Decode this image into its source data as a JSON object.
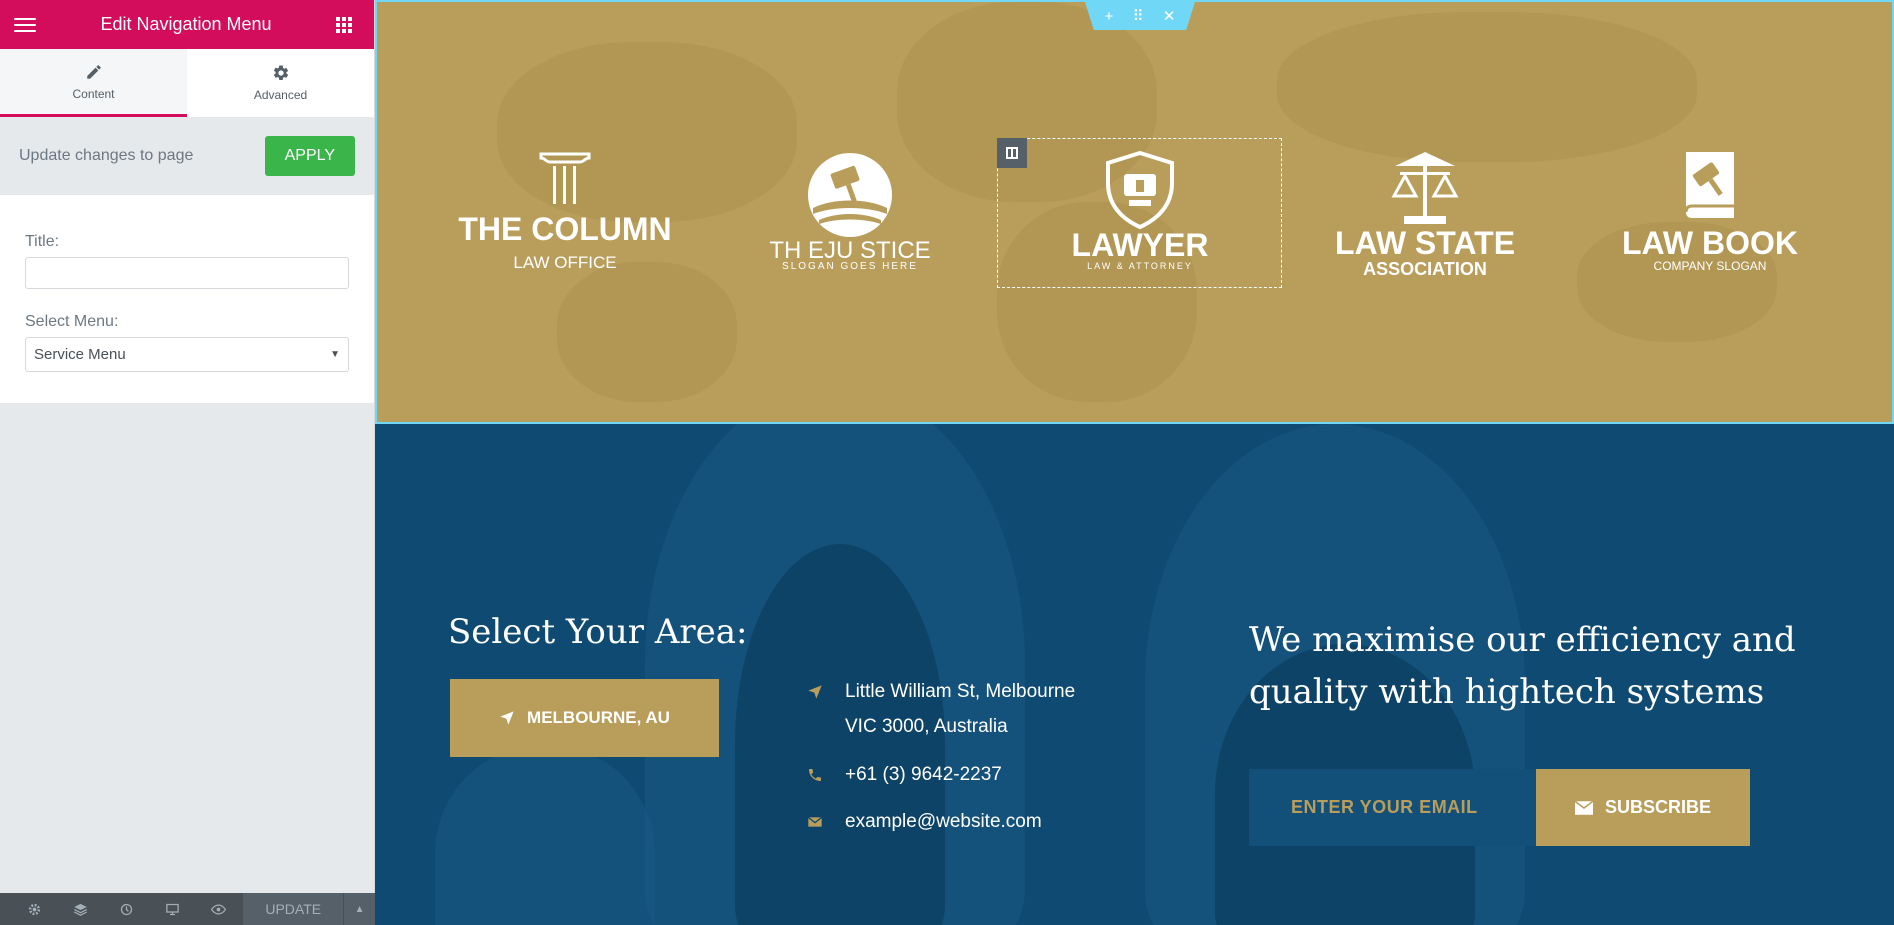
{
  "panel": {
    "header_title": "Edit Navigation Menu",
    "tabs": [
      {
        "label": "Content",
        "icon": "pencil-icon",
        "active": true
      },
      {
        "label": "Advanced",
        "icon": "gear-icon",
        "active": false
      }
    ],
    "apply_text": "Update changes to page",
    "apply_label": "APPLY",
    "title_label": "Title:",
    "title_value": "",
    "menu_label": "Select Menu:",
    "menu_value": "Service Menu",
    "footer": {
      "icons": [
        "settings-icon",
        "layers-icon",
        "history-icon",
        "responsive-icon",
        "preview-icon"
      ],
      "update_label": "UPDATE"
    }
  },
  "logos": [
    {
      "name": "THE COLUMN",
      "sub": "LAW OFFICE",
      "icon": "column-icon"
    },
    {
      "name": "TH EJU STICE",
      "sub": "SLOGAN GOES HERE",
      "icon": "gavel-circle-icon"
    },
    {
      "name": "LAWYER",
      "sub": "LAW & ATTORNEY",
      "icon": "shield-gavel-icon"
    },
    {
      "name": "LAW STATE",
      "sub": "ASSOCIATION",
      "icon": "scales-icon"
    },
    {
      "name": "LAW BOOK",
      "sub": "COMPANY SLOGAN",
      "icon": "book-gavel-icon"
    }
  ],
  "contact": {
    "area_heading": "Select Your Area:",
    "location_label": "MELBOURNE, AU",
    "address_line1": "Little William St, Melbourne",
    "address_line2": "VIC 3000, Australia",
    "phone": "+61 (3) 9642-2237",
    "email": "example@website.com",
    "tagline": "We maximise our efficiency and quality with hightech systems",
    "email_placeholder": "ENTER YOUR EMAIL",
    "subscribe_label": "SUBSCRIBE"
  },
  "colors": {
    "accent": "#d30c5c",
    "gold": "#b99d5b",
    "navy": "#0f4a72",
    "apply_green": "#39b54a",
    "selection": "#71d7f7"
  }
}
